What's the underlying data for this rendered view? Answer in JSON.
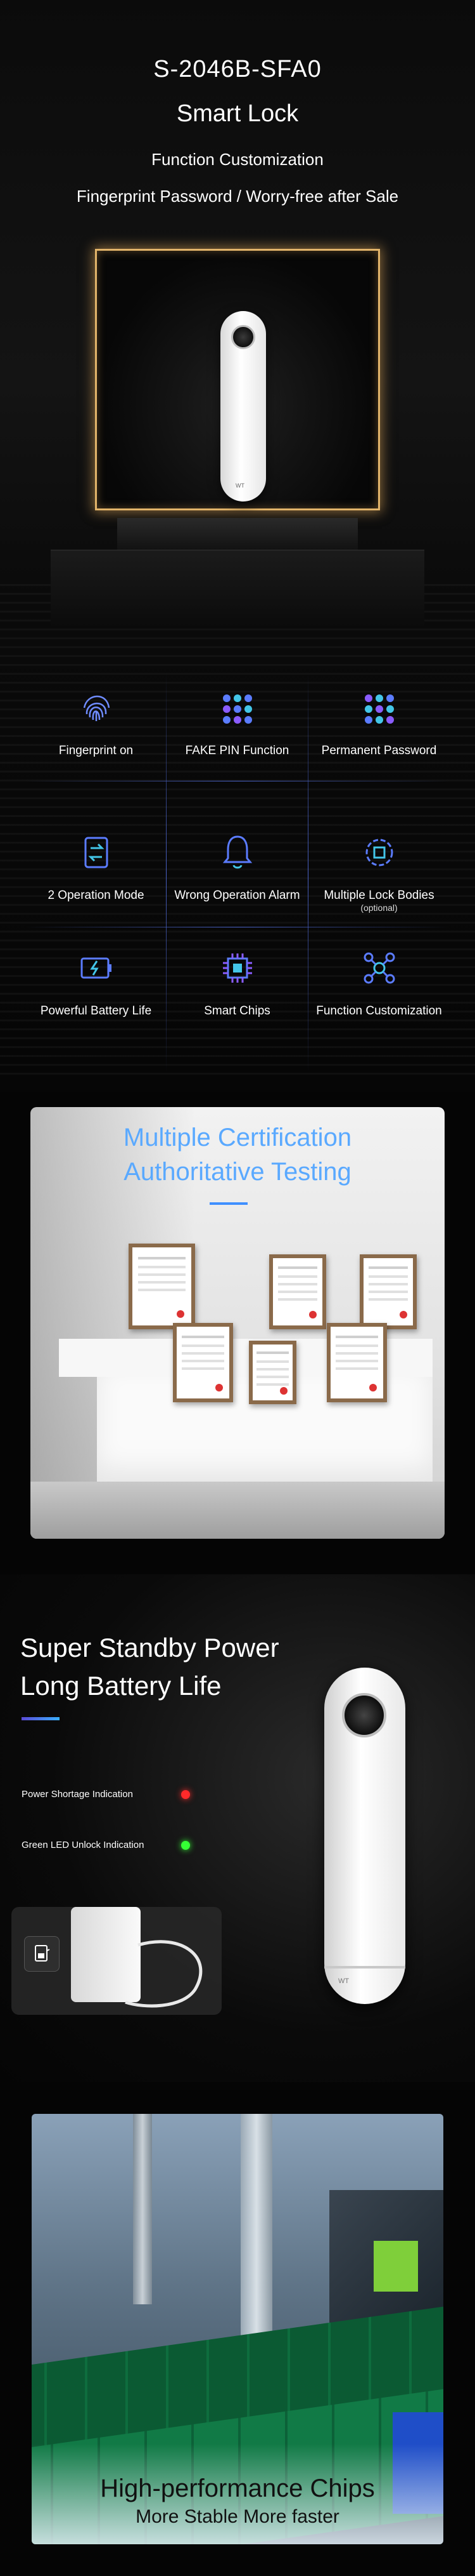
{
  "hero": {
    "model": "S-2046B-SFA0",
    "product": "Smart Lock",
    "subtitle": "Function Customization",
    "tagline": "Fingerprint  Password   /  Worry-free after Sale",
    "lock_logo": "WT"
  },
  "features": [
    {
      "label": "Fingerprint on",
      "sub": "",
      "icon": "fingerprint-icon"
    },
    {
      "label": "FAKE PIN Function",
      "sub": "",
      "icon": "keypad-dots-icon"
    },
    {
      "label": "Permanent Password",
      "sub": "",
      "icon": "password-dots-icon"
    },
    {
      "label": "2 Operation Mode",
      "sub": "",
      "icon": "mode-switch-icon"
    },
    {
      "label": "Wrong Operation Alarm",
      "sub": "",
      "icon": "bell-icon"
    },
    {
      "label": "Multiple Lock Bodies",
      "sub": "(optional)",
      "icon": "gear-cube-icon"
    },
    {
      "label": "Powerful Battery Life",
      "sub": "",
      "icon": "battery-icon"
    },
    {
      "label": "Smart Chips",
      "sub": "",
      "icon": "chip-icon"
    },
    {
      "label": "Function Customization",
      "sub": "",
      "icon": "network-icon"
    }
  ],
  "certification": {
    "line1": "Multiple Certification",
    "line2": "Authoritative Testing"
  },
  "battery": {
    "line1": "Super Standby Power",
    "line2": "Long Battery Life",
    "indicator_red": "Power Shortage Indication",
    "indicator_green": "Green LED Unlock Indication",
    "lock_logo": "WT"
  },
  "chips": {
    "line1": "High-performance Chips",
    "line2": "More Stable More faster"
  },
  "colors": {
    "gold_frame": "#e2b46a",
    "feature_divider": "#4a63c8",
    "cert_text": "#5aa9ff",
    "red_led": "#ff2a2a",
    "green_led": "#35ff35"
  }
}
